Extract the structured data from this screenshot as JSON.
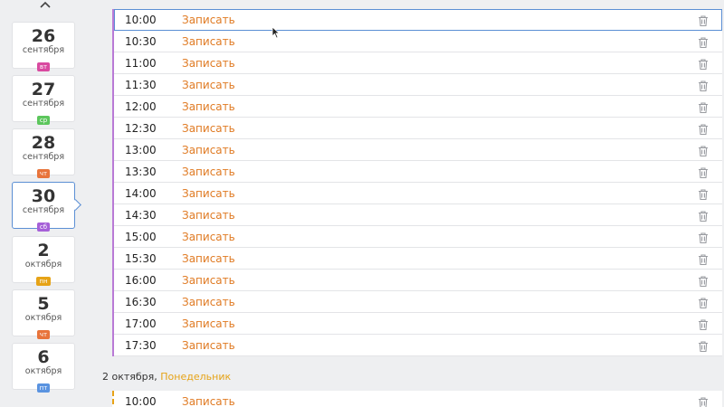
{
  "sidebar": {
    "dates": [
      {
        "day": "26",
        "month": "сентября",
        "weekday": "вт",
        "color": "#d94aa0"
      },
      {
        "day": "27",
        "month": "сентября",
        "weekday": "ср",
        "color": "#5cc65c"
      },
      {
        "day": "28",
        "month": "сентября",
        "weekday": "чт",
        "color": "#e8743b"
      },
      {
        "day": "30",
        "month": "сентября",
        "weekday": "сб",
        "color": "#a660d8",
        "selected": true
      },
      {
        "day": "2",
        "month": "октября",
        "weekday": "пн",
        "color": "#e6a317"
      },
      {
        "day": "5",
        "month": "октября",
        "weekday": "чт",
        "color": "#e8743b"
      },
      {
        "day": "6",
        "month": "октября",
        "weekday": "пт",
        "color": "#5a93e0"
      }
    ]
  },
  "groups": [
    {
      "slots": [
        {
          "time": "10:00",
          "action": "Записать"
        },
        {
          "time": "10:30",
          "action": "Записать"
        },
        {
          "time": "11:00",
          "action": "Записать"
        },
        {
          "time": "11:30",
          "action": "Записать"
        },
        {
          "time": "12:00",
          "action": "Записать"
        },
        {
          "time": "12:30",
          "action": "Записать"
        },
        {
          "time": "13:00",
          "action": "Записать"
        },
        {
          "time": "13:30",
          "action": "Записать"
        },
        {
          "time": "14:00",
          "action": "Записать"
        },
        {
          "time": "14:30",
          "action": "Записать"
        },
        {
          "time": "15:00",
          "action": "Записать"
        },
        {
          "time": "15:30",
          "action": "Записать"
        },
        {
          "time": "16:00",
          "action": "Записать"
        },
        {
          "time": "16:30",
          "action": "Записать"
        },
        {
          "time": "17:00",
          "action": "Записать"
        },
        {
          "time": "17:30",
          "action": "Записать"
        }
      ]
    },
    {
      "header_date": "2 октября,",
      "header_weekday": "Понедельник",
      "slots": [
        {
          "time": "10:00",
          "action": "Записать"
        }
      ]
    }
  ],
  "colors": {
    "accent_orange": "#e07b24",
    "selected_border": "#5b8fd4"
  }
}
